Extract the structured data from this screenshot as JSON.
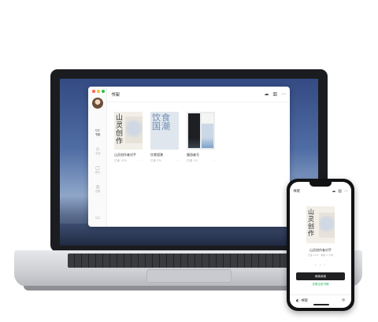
{
  "app": {
    "title": "书架",
    "window_controls": {
      "close_color": "#ff5f57",
      "minimize_color": "#febc2e",
      "zoom_color": "#28c840"
    }
  },
  "toolbar_icons": [
    "cloud-icon",
    "book-icon",
    "more-icon"
  ],
  "sidebar": {
    "items": [
      {
        "label": "书架",
        "icon": "bookshelf-icon",
        "active": true
      },
      {
        "label": "书城",
        "icon": "store-icon",
        "active": false
      },
      {
        "label": "想法",
        "icon": "thought-icon",
        "active": false
      },
      {
        "label": "设置",
        "icon": "settings-icon",
        "active": false
      }
    ]
  },
  "books": [
    {
      "title": "山灵创作者对手",
      "cover_text": "山灵创作",
      "meta": "已读 12%",
      "more": "⋯"
    },
    {
      "title": "饮食国潮",
      "cover_text": "饮食国潮",
      "meta": "已读 3%",
      "more": "⋯"
    },
    {
      "title": "慢游者号",
      "cover_text": "",
      "meta": "已读 1%",
      "more": "⋯"
    }
  ],
  "phone": {
    "title": "书架",
    "book": {
      "title": "山灵创作者对手",
      "cover_text": "山灵创作",
      "meta": "已读 12% · 剩余 2 小时"
    },
    "primary_button": "继续阅读",
    "secondary_link": "查看全部书籍",
    "tab_label": "书架"
  },
  "colors": {
    "accent_green": "#3bb26e",
    "button_dark": "#1f1f22"
  }
}
